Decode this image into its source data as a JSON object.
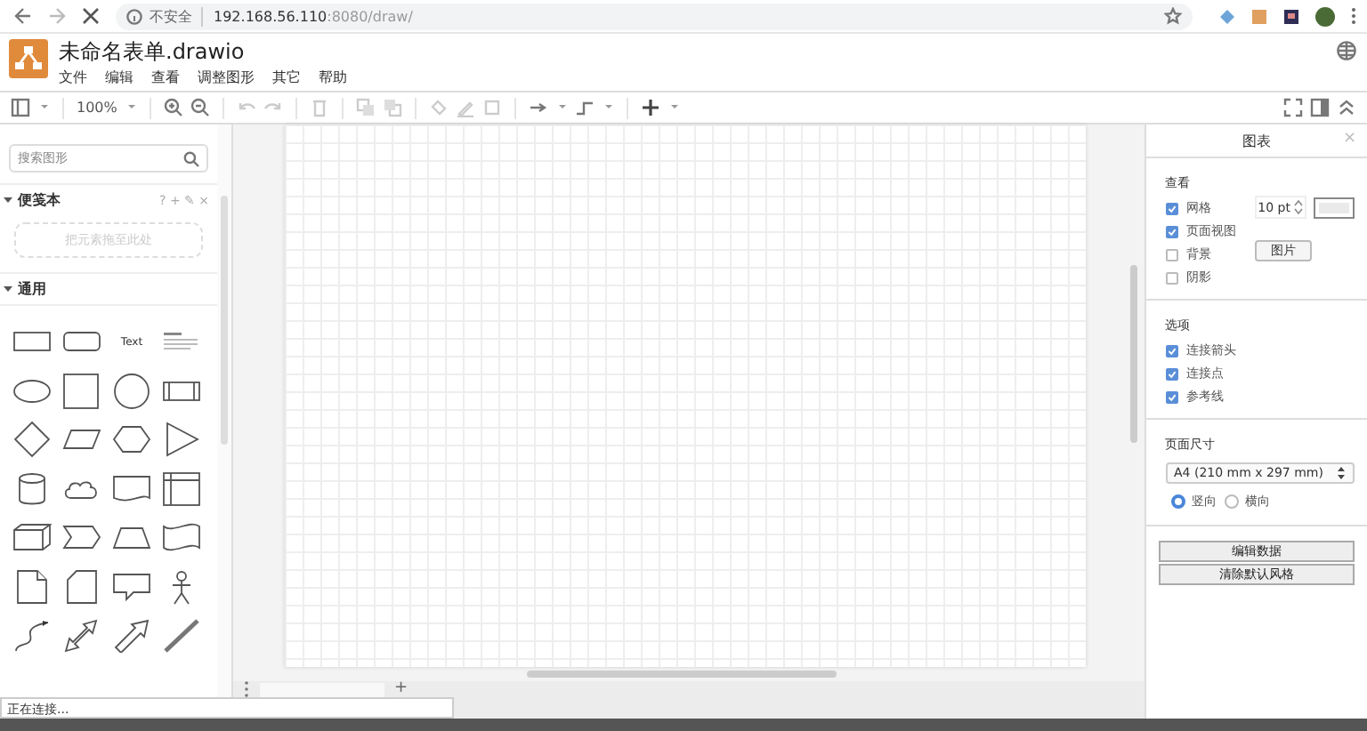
{
  "browser": {
    "security_label": "不安全",
    "url_host": "192.168.56.110",
    "url_path": ":8080/draw/"
  },
  "app": {
    "title": "未命名表单.drawio",
    "menu": [
      "文件",
      "编辑",
      "查看",
      "调整图形",
      "其它",
      "帮助"
    ]
  },
  "toolbar": {
    "zoom": "100%"
  },
  "sidebar": {
    "search": {
      "placeholder": "搜索图形"
    },
    "scratchpad": {
      "title": "便笺本",
      "expanded": true,
      "tools": "? + ✎ ×",
      "drop_hint": "把元素拖至此处"
    },
    "general": {
      "title": "通用",
      "expanded": true,
      "shapes": [
        {
          "kind": "rectangle"
        },
        {
          "kind": "rounded"
        },
        {
          "kind": "text",
          "label": "Text"
        },
        {
          "kind": "heading"
        },
        {
          "kind": "ellipse"
        },
        {
          "kind": "square"
        },
        {
          "kind": "circle"
        },
        {
          "kind": "process"
        },
        {
          "kind": "diamond"
        },
        {
          "kind": "parallelogram"
        },
        {
          "kind": "hexagon"
        },
        {
          "kind": "triangle"
        },
        {
          "kind": "cylinder"
        },
        {
          "kind": "cloud"
        },
        {
          "kind": "document"
        },
        {
          "kind": "storage"
        },
        {
          "kind": "cube"
        },
        {
          "kind": "step"
        },
        {
          "kind": "trapezoid"
        },
        {
          "kind": "tape"
        },
        {
          "kind": "note"
        },
        {
          "kind": "card"
        },
        {
          "kind": "callout"
        },
        {
          "kind": "actor"
        },
        {
          "kind": "curve"
        },
        {
          "kind": "double-arrow"
        },
        {
          "kind": "arrow"
        },
        {
          "kind": "line"
        }
      ]
    }
  },
  "pages": {
    "add": "+"
  },
  "format_panel": {
    "title": "图表",
    "close": "×",
    "view": {
      "title": "查看",
      "options": [
        {
          "label": "网格",
          "checked": true
        },
        {
          "label": "页面视图",
          "checked": true
        },
        {
          "label": "背景",
          "checked": false
        },
        {
          "label": "阴影",
          "checked": false
        }
      ],
      "grid_size": "10 pt",
      "image_button": "图片"
    },
    "options": {
      "title": "选项",
      "options": [
        {
          "label": "连接箭头",
          "checked": true
        },
        {
          "label": "连接点",
          "checked": true
        },
        {
          "label": "参考线",
          "checked": true
        }
      ]
    },
    "page_size": {
      "title": "页面尺寸",
      "value": "A4 (210 mm x 297 mm)",
      "orientations": [
        {
          "label": "竖向",
          "selected": true
        },
        {
          "label": "横向",
          "selected": false
        }
      ]
    },
    "buttons": [
      "编辑数据",
      "清除默认风格"
    ]
  },
  "status": "正在连接..."
}
